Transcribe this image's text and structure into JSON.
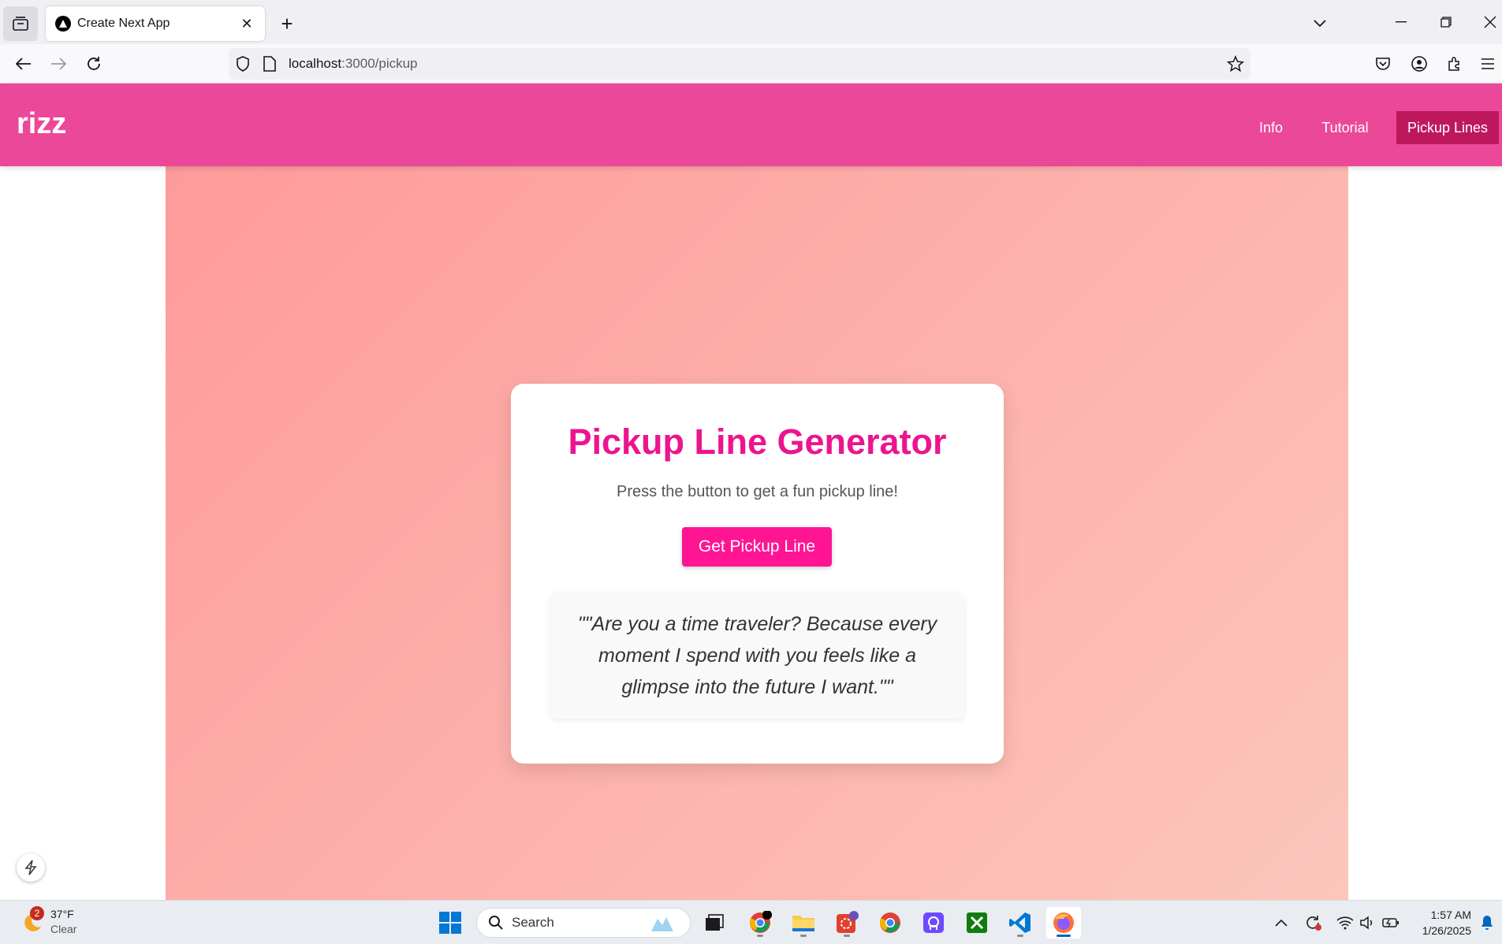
{
  "browser": {
    "tab_title": "Create Next App",
    "url_host": "localhost",
    "url_path": ":3000/pickup"
  },
  "app": {
    "brand": "rizz",
    "nav": [
      {
        "label": "Info"
      },
      {
        "label": "Tutorial"
      },
      {
        "label": "Pickup Lines"
      }
    ],
    "active_nav": "Pickup Lines"
  },
  "card": {
    "title": "Pickup Line Generator",
    "subtitle": "Press the button to get a fun pickup line!",
    "button_label": "Get Pickup Line",
    "pickup_line": "\"\"Are you a time traveler? Because every moment I spend with you feels like a glimpse into the future I want.\"\""
  },
  "colors": {
    "header": "#ec4899",
    "active_nav": "#be185d",
    "title": "#ec148f",
    "button": "#ff1493"
  },
  "taskbar": {
    "weather_temp": "37°F",
    "weather_cond": "Clear",
    "weather_badge": "2",
    "search_label": "Search",
    "time": "1:57 AM",
    "date": "1/26/2025",
    "pinned_icons": [
      "windows-start-icon",
      "search-icon",
      "task-view-icon",
      "chrome-icon",
      "file-explorer-icon",
      "app-icon",
      "chrome-icon",
      "proton-icon",
      "xbox-icon",
      "vscode-icon",
      "firefox-icon"
    ]
  }
}
